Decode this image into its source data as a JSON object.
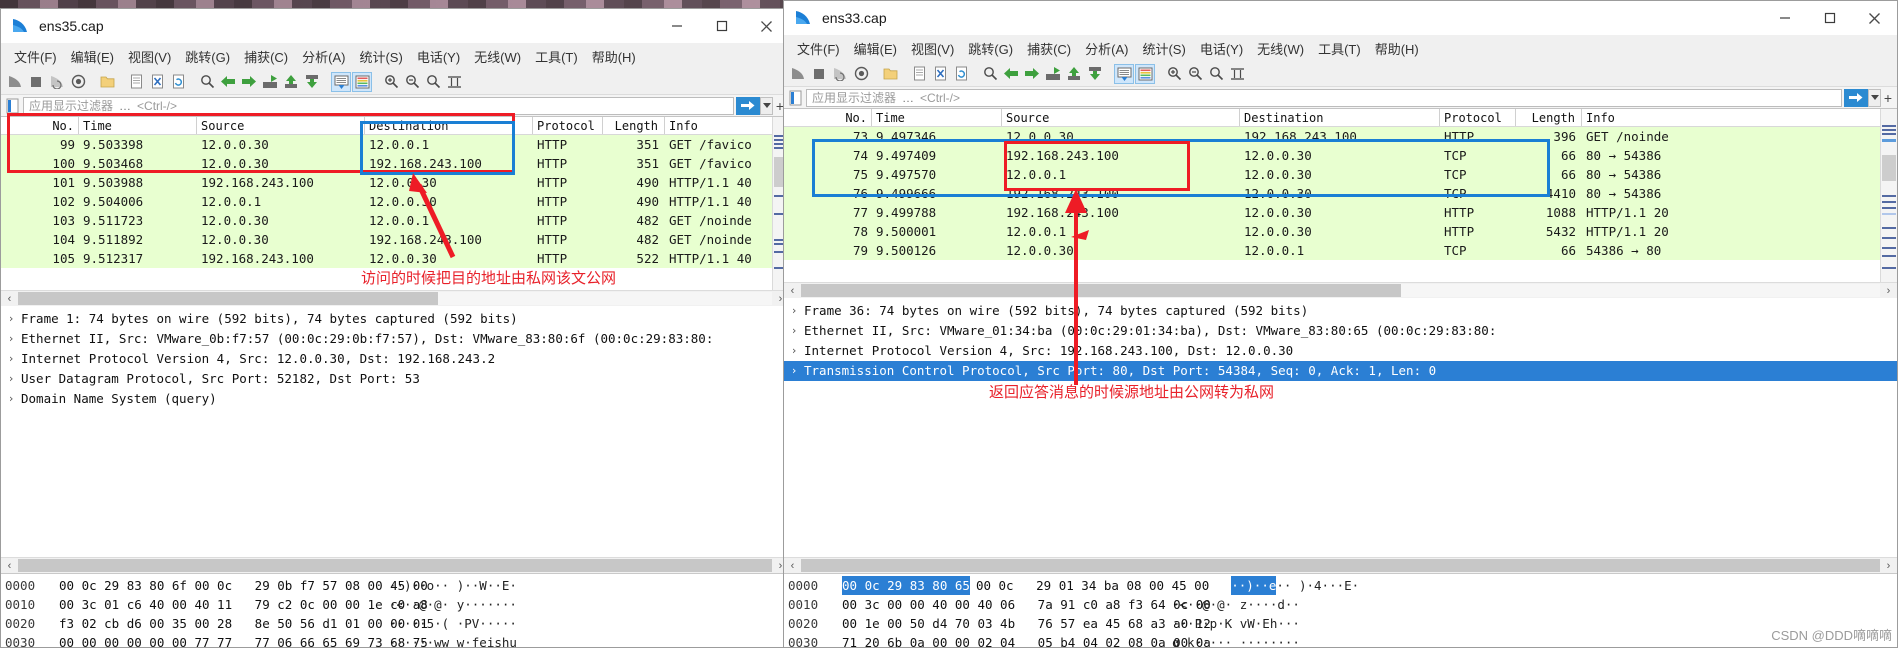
{
  "windows": [
    {
      "id": "left",
      "title": "ens35.cap",
      "menus": [
        "文件(F)",
        "编辑(E)",
        "视图(V)",
        "跳转(G)",
        "捕获(C)",
        "分析(A)",
        "统计(S)",
        "电话(Y)",
        "无线(W)",
        "工具(T)",
        "帮助(H)"
      ],
      "filter": {
        "placeholder": "应用显示过滤器",
        "hint": "<Ctrl-/>",
        "value": ""
      },
      "columns": [
        "No.",
        "Time",
        "Source",
        "Destination",
        "Protocol",
        "Length",
        "Info"
      ],
      "rows": [
        {
          "no": "99",
          "time": "9.503398",
          "src": "12.0.0.30",
          "dst": "12.0.0.1",
          "proto": "HTTP",
          "len": "351",
          "info": "GET /favico"
        },
        {
          "no": "100",
          "time": "9.503468",
          "src": "12.0.0.30",
          "dst": "192.168.243.100",
          "proto": "HTTP",
          "len": "351",
          "info": "GET /favico"
        },
        {
          "no": "101",
          "time": "9.503988",
          "src": "192.168.243.100",
          "dst": "12.0.0.30",
          "proto": "HTTP",
          "len": "490",
          "info": "HTTP/1.1 40"
        },
        {
          "no": "102",
          "time": "9.504006",
          "src": "12.0.0.1",
          "dst": "12.0.0.30",
          "proto": "HTTP",
          "len": "490",
          "info": "HTTP/1.1 40"
        },
        {
          "no": "103",
          "time": "9.511723",
          "src": "12.0.0.30",
          "dst": "12.0.0.1",
          "proto": "HTTP",
          "len": "482",
          "info": "GET /noinde"
        },
        {
          "no": "104",
          "time": "9.511892",
          "src": "12.0.0.30",
          "dst": "192.168.243.100",
          "proto": "HTTP",
          "len": "482",
          "info": "GET /noinde"
        },
        {
          "no": "105",
          "time": "9.512317",
          "src": "192.168.243.100",
          "dst": "12.0.0.30",
          "proto": "HTTP",
          "len": "522",
          "info": "HTTP/1.1 40"
        }
      ],
      "details": [
        {
          "text": "Frame 1: 74 bytes on wire (592 bits), 74 bytes captured (592 bits)",
          "selected": false
        },
        {
          "text": "Ethernet II, Src: VMware_0b:f7:57 (00:0c:29:0b:f7:57), Dst: VMware_83:80:6f (00:0c:29:83:80:",
          "selected": false
        },
        {
          "text": "Internet Protocol Version 4, Src: 12.0.0.30, Dst: 192.168.243.2",
          "selected": false
        },
        {
          "text": "User Datagram Protocol, Src Port: 52182, Dst Port: 53",
          "selected": false
        },
        {
          "text": "Domain Name System (query)",
          "selected": false
        }
      ],
      "hex": [
        {
          "off": "0000",
          "bytes": "00 0c 29 83 80 6f 00 0c   29 0b f7 57 08 00 45 00",
          "ascii": "··)··o·· )··W··E·",
          "hl": false
        },
        {
          "off": "0010",
          "bytes": "00 3c 01 c6 40 00 40 11   79 c2 0c 00 00 1e c0 a8",
          "ascii": "·<··@·@· y·······",
          "hl": false
        },
        {
          "off": "0020",
          "bytes": "f3 02 cb d6 00 35 00 28   8e 50 56 d1 01 00 00 01",
          "ascii": "·····5·( ·PV·····",
          "hl": false
        },
        {
          "off": "0030",
          "bytes": "00 00 00 00 00 00 77 77   77 06 66 65 69 73 68 75",
          "ascii": "······ww w·feishu",
          "hl": false
        }
      ]
    },
    {
      "id": "right",
      "title": "ens33.cap",
      "menus": [
        "文件(F)",
        "编辑(E)",
        "视图(V)",
        "跳转(G)",
        "捕获(C)",
        "分析(A)",
        "统计(S)",
        "电话(Y)",
        "无线(W)",
        "工具(T)",
        "帮助(H)"
      ],
      "filter": {
        "placeholder": "应用显示过滤器",
        "hint": "<Ctrl-/>",
        "value": ""
      },
      "columns": [
        "No.",
        "Time",
        "Source",
        "Destination",
        "Protocol",
        "Length",
        "Info"
      ],
      "rows": [
        {
          "no": "73",
          "time": "9.497346",
          "src": "12.0.0.30",
          "dst": "192.168.243.100",
          "proto": "HTTP",
          "len": "396",
          "info": "GET /noinde"
        },
        {
          "no": "74",
          "time": "9.497409",
          "src": "192.168.243.100",
          "dst": "12.0.0.30",
          "proto": "TCP",
          "len": "66",
          "info": "80 → 54386"
        },
        {
          "no": "75",
          "time": "9.497570",
          "src": "12.0.0.1",
          "dst": "12.0.0.30",
          "proto": "TCP",
          "len": "66",
          "info": "80 → 54386"
        },
        {
          "no": "76",
          "time": "9.499666",
          "src": "192.168.243.100",
          "dst": "12.0.0.30",
          "proto": "TCP",
          "len": "4410",
          "info": "80 → 54386"
        },
        {
          "no": "77",
          "time": "9.499788",
          "src": "192.168.243.100",
          "dst": "12.0.0.30",
          "proto": "HTTP",
          "len": "1088",
          "info": "HTTP/1.1 20"
        },
        {
          "no": "78",
          "time": "9.500001",
          "src": "12.0.0.1",
          "dst": "12.0.0.30",
          "proto": "HTTP",
          "len": "5432",
          "info": "HTTP/1.1 20"
        },
        {
          "no": "79",
          "time": "9.500126",
          "src": "12.0.0.30",
          "dst": "12.0.0.1",
          "proto": "TCP",
          "len": "66",
          "info": "54386 → 80"
        }
      ],
      "details": [
        {
          "text": "Frame 36: 74 bytes on wire (592 bits), 74 bytes captured (592 bits)",
          "selected": false
        },
        {
          "text": "Ethernet II, Src: VMware_01:34:ba (00:0c:29:01:34:ba), Dst: VMware_83:80:65 (00:0c:29:83:80:",
          "selected": false
        },
        {
          "text": "Internet Protocol Version 4, Src: 192.168.243.100, Dst: 12.0.0.30",
          "selected": false
        },
        {
          "text": "Transmission Control Protocol, Src Port: 80, Dst Port: 54384, Seq: 0, Ack: 1, Len: 0",
          "selected": true
        }
      ],
      "hex": [
        {
          "off": "0000",
          "bytes": "00 0c 29 83 80 65",
          "bytes2": "00 0c   29 01 34 ba 08 00 45 00",
          "ascii1": "··)··e",
          "ascii2": "·· )·4···E·",
          "hl": true
        },
        {
          "off": "0010",
          "bytes": "00 3c 00 00 40 00 40 06   7a 91 c0 a8 f3 64 0c 00",
          "ascii": "·<··@·@· z····d··",
          "hl": false
        },
        {
          "off": "0020",
          "bytes": "00 1e 00 50 d4 70 03 4b   76 57 ea 45 68 a3 a0 12",
          "ascii": "···P·p·K vW·Eh···",
          "hl": false
        },
        {
          "off": "0030",
          "bytes": "71 20 6b 0a 00 00 02 04   05 b4 04 02 08 0a 00 0a",
          "ascii": "q k····· ········",
          "hl": false
        }
      ]
    }
  ],
  "annotations": {
    "left_note": "访问的时候把目的地址由私网该文公网",
    "right_note": "返回应答消息的时候源地址由公网转为私网"
  },
  "watermark": "CSDN @DDD嘀嘀嘀",
  "colors": {
    "red": "#ee1c25",
    "blue": "#1a7fd4",
    "row_bg": "#e8ffd0",
    "select": "#2b7fd4"
  }
}
